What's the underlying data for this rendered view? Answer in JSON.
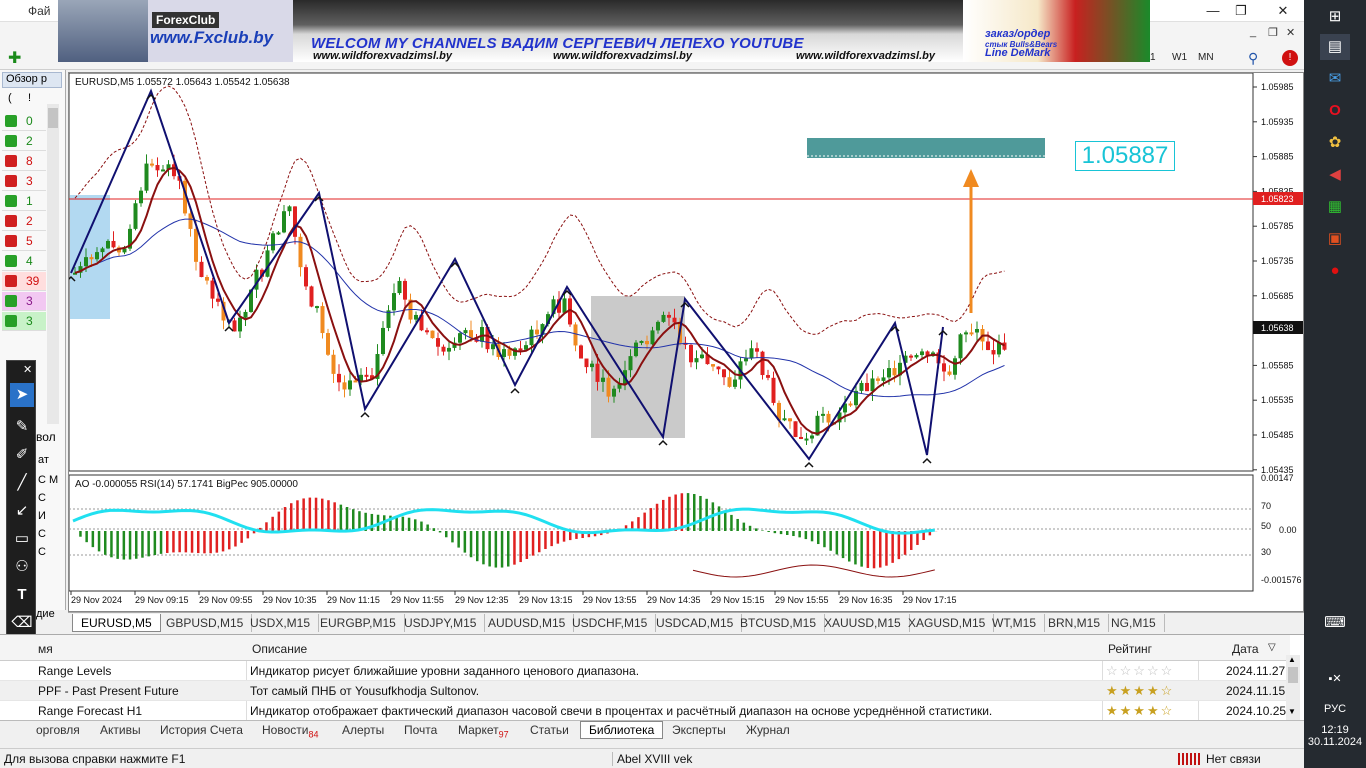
{
  "window": {
    "menu_first": "Фай",
    "win_min": "—",
    "win_max": "❐",
    "win_close": "✕",
    "child_min": "_",
    "child_restore": "❐",
    "child_close": "✕"
  },
  "toolbar": {
    "tf_w1": "W1",
    "tf_mn": "MN",
    "tf_h1": "1"
  },
  "banner": {
    "forexclub_label": "ForexClub",
    "url": "www.Fxclub.by",
    "headline": "WELCOM MY CHANNELS ВАДИМ СЕРГЕЕВИЧ ЛЕПЕХО YOUTUBE",
    "site1": "www.wildforexvadzimsl.by",
    "site2": "www.wildforexvadzimsl.by",
    "site3": "www.wildforexvadzimsl.by",
    "order": "заказ/ордер",
    "bullsbears": "стык Bulls&Bears",
    "demark": "Line DeMark"
  },
  "market_watch": {
    "header": "Обзор р",
    "col_header_left": "(",
    "col_header_right": "!",
    "rows": [
      {
        "value": "0",
        "color": "#1a8a1a",
        "up": true
      },
      {
        "value": "2",
        "color": "#1a8a1a",
        "up": true
      },
      {
        "value": "8",
        "color": "#d01010",
        "up": false
      },
      {
        "value": "3",
        "color": "#d01010",
        "up": false
      },
      {
        "value": "1",
        "color": "#1a8a1a",
        "up": true
      },
      {
        "value": "2",
        "color": "#d01010",
        "up": false
      },
      {
        "value": "5",
        "color": "#d01010",
        "up": false
      },
      {
        "value": "4",
        "color": "#1a8a1a",
        "up": true
      },
      {
        "value": "39",
        "color": "#d01010",
        "up": false
      },
      {
        "value": "3",
        "color": "#8a1a8a",
        "up": true
      },
      {
        "value": "3",
        "color": "#1a8a1a",
        "up": true
      }
    ],
    "side_label_1": "вол",
    "side_label_2": "ат",
    "side_label_3": "дие",
    "list_letters": [
      "С М",
      "С",
      "И",
      "С",
      "С"
    ]
  },
  "chart": {
    "header": "EURUSD,M5  1.05572 1.05643 1.05542 1.05638",
    "sub_header": "AO -0.000055  RSI(14) 57.1741  BigPec 905.00000",
    "target_label": "1.05887",
    "price_labels": [
      "1.05985",
      "1.05935",
      "1.05885",
      "1.05835",
      "1.05785",
      "1.05735",
      "1.05685",
      "1.05635",
      "1.05585",
      "1.05535",
      "1.05485",
      "1.05435"
    ],
    "red_line_label": "1.05823",
    "current_label": "1.05638",
    "sub_labels": [
      "0.00147",
      "70",
      "50",
      "30",
      "-0.001576"
    ],
    "sub_label_zero": "0.00",
    "time_labels": [
      "29 Nov 2024",
      "29 Nov 09:15",
      "29 Nov 09:55",
      "29 Nov 10:35",
      "29 Nov 11:15",
      "29 Nov 11:55",
      "29 Nov 12:35",
      "29 Nov 13:15",
      "29 Nov 13:55",
      "29 Nov 14:35",
      "29 Nov 15:15",
      "29 Nov 15:55",
      "29 Nov 16:35",
      "29 Nov 17:15"
    ]
  },
  "symbol_tabs": [
    "EURUSD,M5",
    "GBPUSD,M15",
    "USDX,M15",
    "EURGBP,M15",
    "USDJPY,M15",
    "AUDUSD,M15",
    "USDCHF,M15",
    "USDCAD,M15",
    "BTCUSD,M15",
    "XAUUSD,M15",
    "XAGUSD,M15",
    "WT,M15",
    "BRN,M15",
    "NG,M15"
  ],
  "library": {
    "col_name": "мя",
    "col_desc": "Описание",
    "col_rating": "Рейтинг",
    "col_date": "Дата",
    "rows": [
      {
        "name": "Range Levels",
        "desc": "Индикатор рисует ближайшие уровни заданного ценового диапазона.",
        "stars": "☆☆☆☆☆",
        "filled": false,
        "date": "2024.11.27"
      },
      {
        "name": "PPF - Past Present Future",
        "desc": "Тот самый ПНБ от Yousufkhodja Sultonov.",
        "stars": "★★★★☆",
        "filled": true,
        "date": "2024.11.15"
      },
      {
        "name": "Range Forecast H1",
        "desc": "Индикатор отображает фактический диапазон часовой свечи в процентах и расчётный диапазон на основе усреднённой статистики.",
        "stars": "★★★★☆",
        "filled": true,
        "date": "2024.10.25"
      }
    ]
  },
  "bottom_tabs": [
    {
      "label": "орговля",
      "count": ""
    },
    {
      "label": "Активы",
      "count": ""
    },
    {
      "label": "История Счета",
      "count": ""
    },
    {
      "label": "Новости",
      "count": "84"
    },
    {
      "label": "Алерты",
      "count": ""
    },
    {
      "label": "Почта",
      "count": ""
    },
    {
      "label": "Маркет",
      "count": "97"
    },
    {
      "label": "Статьи",
      "count": ""
    },
    {
      "label": "Библиотека",
      "count": "",
      "active": true
    },
    {
      "label": "Эксперты",
      "count": ""
    },
    {
      "label": "Журнал",
      "count": ""
    }
  ],
  "status": {
    "help": "Для вызова справки нажмите F1",
    "profile": "Abel XVIII vek",
    "connection": "Нет связи"
  },
  "taskbar": {
    "lang": "РУС",
    "time": "12:19",
    "date": "30.11.2024"
  }
}
